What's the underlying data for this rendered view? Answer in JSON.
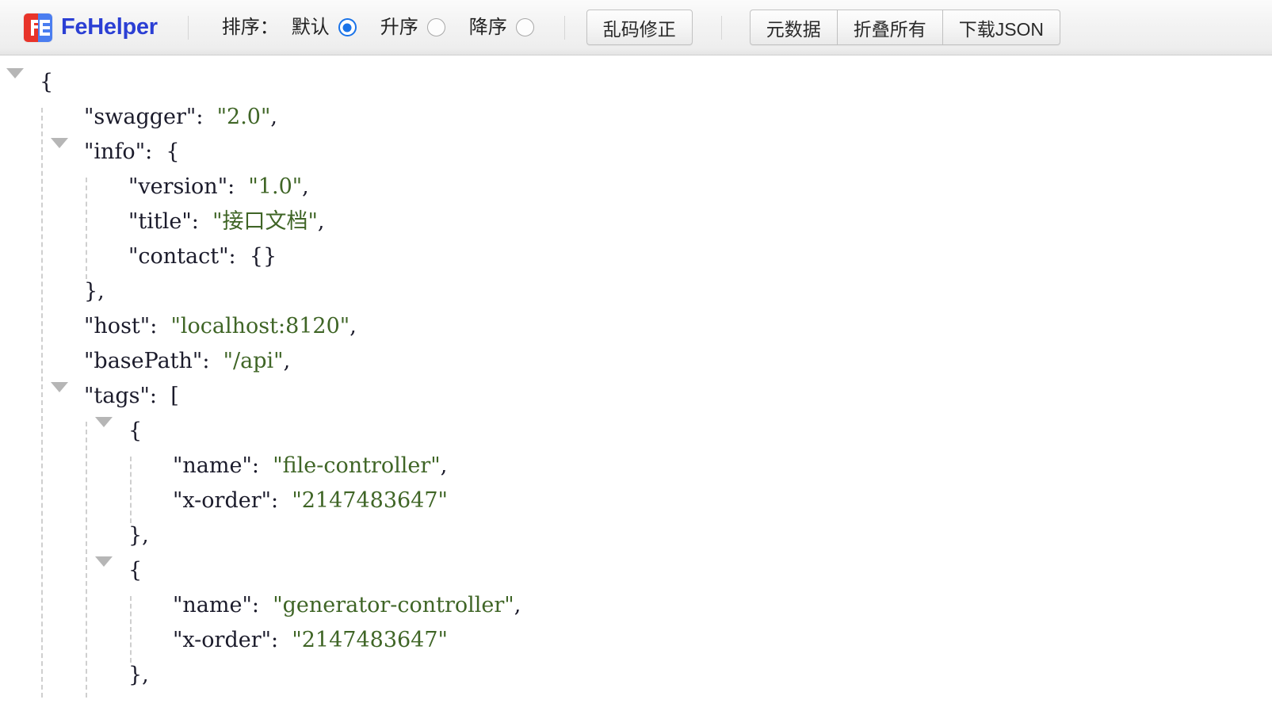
{
  "app": {
    "brand_name": "FeHelper",
    "logo_icon": "fehelper-logo-icon"
  },
  "toolbar": {
    "sort_label": "排序：",
    "sort_options": [
      {
        "label": "默认",
        "selected": true
      },
      {
        "label": "升序",
        "selected": false
      },
      {
        "label": "降序",
        "selected": false
      }
    ],
    "encoding_fix_label": "乱码修正",
    "actions": [
      {
        "label": "元数据"
      },
      {
        "label": "折叠所有"
      },
      {
        "label": "下载JSON"
      }
    ]
  },
  "viewer": {
    "lines": [
      {
        "indent": 0,
        "toggle": true,
        "tokens": [
          {
            "t": "punc",
            "v": "{"
          }
        ]
      },
      {
        "indent": 1,
        "toggle": false,
        "tokens": [
          {
            "t": "key",
            "v": "\"swagger\":"
          },
          {
            "t": "punc",
            "v": "  "
          },
          {
            "t": "str",
            "v": "\"2.0\""
          },
          {
            "t": "punc",
            "v": ","
          }
        ]
      },
      {
        "indent": 1,
        "toggle": true,
        "tokens": [
          {
            "t": "key",
            "v": "\"info\":"
          },
          {
            "t": "punc",
            "v": "  {"
          }
        ]
      },
      {
        "indent": 2,
        "toggle": false,
        "tokens": [
          {
            "t": "key",
            "v": "\"version\":"
          },
          {
            "t": "punc",
            "v": "  "
          },
          {
            "t": "str",
            "v": "\"1.0\""
          },
          {
            "t": "punc",
            "v": ","
          }
        ]
      },
      {
        "indent": 2,
        "toggle": false,
        "tokens": [
          {
            "t": "key",
            "v": "\"title\":"
          },
          {
            "t": "punc",
            "v": "  "
          },
          {
            "t": "str",
            "v": "\"接口文档\""
          },
          {
            "t": "punc",
            "v": ","
          }
        ]
      },
      {
        "indent": 2,
        "toggle": false,
        "tokens": [
          {
            "t": "key",
            "v": "\"contact\":"
          },
          {
            "t": "punc",
            "v": "  {}"
          }
        ]
      },
      {
        "indent": 1,
        "toggle": false,
        "tokens": [
          {
            "t": "punc",
            "v": "},"
          }
        ]
      },
      {
        "indent": 1,
        "toggle": false,
        "tokens": [
          {
            "t": "key",
            "v": "\"host\":"
          },
          {
            "t": "punc",
            "v": "  "
          },
          {
            "t": "str",
            "v": "\"localhost:8120\""
          },
          {
            "t": "punc",
            "v": ","
          }
        ]
      },
      {
        "indent": 1,
        "toggle": false,
        "tokens": [
          {
            "t": "key",
            "v": "\"basePath\":"
          },
          {
            "t": "punc",
            "v": "  "
          },
          {
            "t": "str",
            "v": "\"/api\""
          },
          {
            "t": "punc",
            "v": ","
          }
        ]
      },
      {
        "indent": 1,
        "toggle": true,
        "tokens": [
          {
            "t": "key",
            "v": "\"tags\":"
          },
          {
            "t": "punc",
            "v": "  ["
          }
        ]
      },
      {
        "indent": 2,
        "toggle": true,
        "tokens": [
          {
            "t": "punc",
            "v": "{"
          }
        ]
      },
      {
        "indent": 3,
        "toggle": false,
        "tokens": [
          {
            "t": "key",
            "v": "\"name\":"
          },
          {
            "t": "punc",
            "v": "  "
          },
          {
            "t": "str",
            "v": "\"file-controller\""
          },
          {
            "t": "punc",
            "v": ","
          }
        ]
      },
      {
        "indent": 3,
        "toggle": false,
        "tokens": [
          {
            "t": "key",
            "v": "\"x-order\":"
          },
          {
            "t": "punc",
            "v": "  "
          },
          {
            "t": "str",
            "v": "\"2147483647\""
          }
        ]
      },
      {
        "indent": 2,
        "toggle": false,
        "tokens": [
          {
            "t": "punc",
            "v": "},"
          }
        ]
      },
      {
        "indent": 2,
        "toggle": true,
        "tokens": [
          {
            "t": "punc",
            "v": "{"
          }
        ]
      },
      {
        "indent": 3,
        "toggle": false,
        "tokens": [
          {
            "t": "key",
            "v": "\"name\":"
          },
          {
            "t": "punc",
            "v": "  "
          },
          {
            "t": "str",
            "v": "\"generator-controller\""
          },
          {
            "t": "punc",
            "v": ","
          }
        ]
      },
      {
        "indent": 3,
        "toggle": false,
        "tokens": [
          {
            "t": "key",
            "v": "\"x-order\":"
          },
          {
            "t": "punc",
            "v": "  "
          },
          {
            "t": "str",
            "v": "\"2147483647\""
          }
        ]
      },
      {
        "indent": 2,
        "toggle": false,
        "tokens": [
          {
            "t": "punc",
            "v": "},"
          }
        ]
      }
    ]
  },
  "colors": {
    "brand_blue": "#2b3fd4",
    "logo_red": "#e8342a",
    "logo_blue": "#4a7df0",
    "radio_accent": "#1a73e8",
    "string_green": "#3f6526",
    "key_dark": "#1b1b2b",
    "guide_gray": "#cfcfcf",
    "triangle_gray": "#b6b6b6"
  }
}
